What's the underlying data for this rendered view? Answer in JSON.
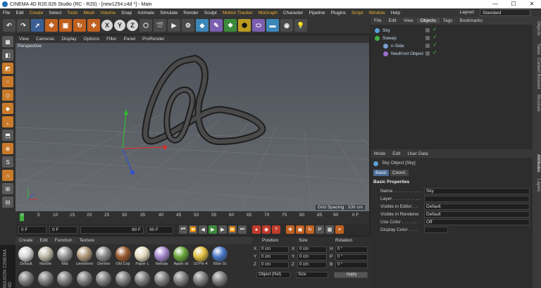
{
  "window": {
    "title": "CINEMA 4D R20.026 Studio (RC - R20) - [new1254.c4d *] - Main",
    "min": "—",
    "max": "☐",
    "close": "✕"
  },
  "menubar": {
    "items": [
      "File",
      "Edit",
      "Create",
      "Select",
      "Tools",
      "Mesh",
      "Volume",
      "Snap",
      "Animate",
      "Simulate",
      "Render",
      "Sculpt",
      "Motion Tracker",
      "MoGraph",
      "Character",
      "Pipeline",
      "Plugins",
      "Script",
      "Window",
      "Help"
    ],
    "layout_label": "Layout:",
    "layout_value": "Standard"
  },
  "viewport": {
    "menu": [
      "View",
      "Cameras",
      "Display",
      "Options",
      "Filter",
      "Panel",
      "ProRender"
    ],
    "camera": "Perspective",
    "grid_spacing": "Grid Spacing : 100 cm"
  },
  "timeline": {
    "ticks": [
      "0",
      "5",
      "10",
      "15",
      "20",
      "25",
      "30",
      "35",
      "40",
      "45",
      "50",
      "55",
      "60",
      "65",
      "70",
      "75",
      "80",
      "85",
      "90"
    ],
    "end_marker": "0 F"
  },
  "playback": {
    "start": "0 F",
    "current": "0 F",
    "end": "90 F",
    "end2": "90 F"
  },
  "materials": {
    "menu": [
      "Create",
      "Edit",
      "Function",
      "Texture"
    ],
    "items": [
      {
        "name": "Default",
        "color": "#d8d8d8"
      },
      {
        "name": "Marble",
        "color": "#bfb9a8"
      },
      {
        "name": "Mat",
        "color": "#9a9a9a"
      },
      {
        "name": "Limestone",
        "color": "#b19a7a"
      },
      {
        "name": "Dented",
        "color": "#8c8c8c"
      },
      {
        "name": "Old Cop",
        "color": "#9b5a2e"
      },
      {
        "name": "Paper L",
        "color": "#e6dcc0"
      },
      {
        "name": "Nebula",
        "color": "#a78ad0"
      },
      {
        "name": "Apple sk",
        "color": "#6aa83a"
      },
      {
        "name": "10 Pin 4",
        "color": "#e0c040"
      },
      {
        "name": "Blue Gl",
        "color": "#4a78c8"
      }
    ]
  },
  "coordinates": {
    "headers": [
      "Position",
      "Size",
      "Rotation"
    ],
    "rows": [
      {
        "axis": "X",
        "pos": "0 cm",
        "saxis": "X",
        "size": "0 cm",
        "raxis": "H",
        "rot": "0 °"
      },
      {
        "axis": "Y",
        "pos": "0 cm",
        "saxis": "Y",
        "size": "0 cm",
        "raxis": "P",
        "rot": "0 °"
      },
      {
        "axis": "Z",
        "pos": "0 cm",
        "saxis": "Z",
        "size": "0 cm",
        "raxis": "B",
        "rot": "0 °"
      }
    ],
    "mode": "Object (Rel)",
    "size_mode": "Size",
    "apply": "Apply"
  },
  "objects": {
    "tabs": [
      "File",
      "Edit",
      "View",
      "Objects",
      "Tags",
      "Bookmarks"
    ],
    "items": [
      {
        "name": "Sky",
        "color": "#5aa0d8"
      },
      {
        "name": "Sweep",
        "color": "#40b040"
      },
      {
        "name": "n-Side",
        "color": "#7aa0d0"
      },
      {
        "name": "NeoKnot Object",
        "color": "#9a70d0"
      }
    ]
  },
  "attributes": {
    "menu": [
      "Mode",
      "Edit",
      "User Data"
    ],
    "object_title": "Sky Object [Sky]",
    "tabs": [
      "Basic",
      "Coord."
    ],
    "section": "Basic Properties",
    "rows": [
      {
        "label": "Name . . . . . . . . . . .",
        "value": "Sky"
      },
      {
        "label": "Layer . . . . . . . . . . .",
        "value": ""
      },
      {
        "label": "Visible in Editor . .",
        "value": "Default"
      },
      {
        "label": "Visible in Renderer",
        "value": "Default"
      },
      {
        "label": "Use Color . . . . . . .",
        "value": "Off"
      },
      {
        "label": "Display Color . . . .",
        "value": ""
      }
    ]
  },
  "right_tabs": [
    "Objects",
    "Takes",
    "Content Browser",
    "Structure",
    "Attributes",
    "Layers"
  ],
  "maxon": "MAXON CINEMA 4D"
}
